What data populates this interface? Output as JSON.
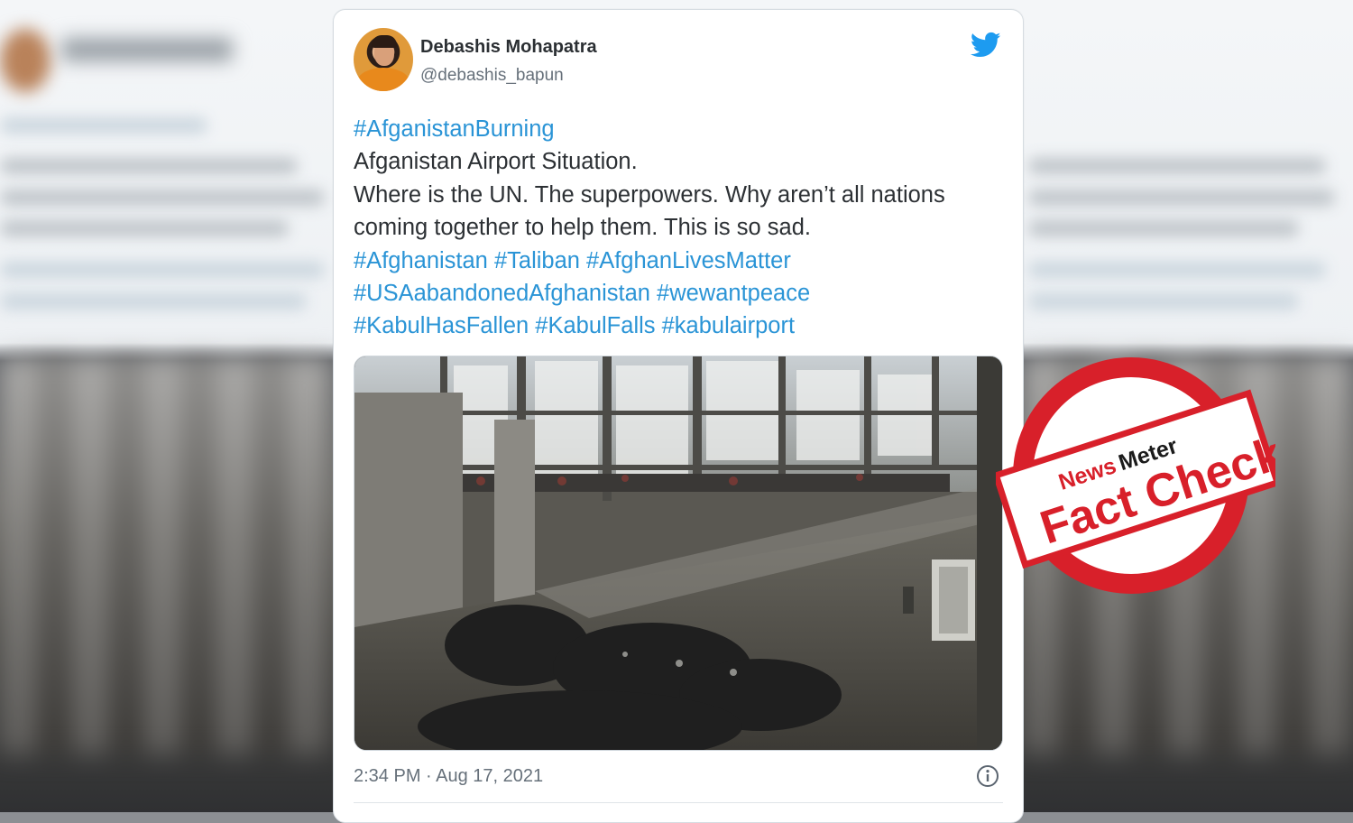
{
  "tweet": {
    "author_name": "Debashis Mohapatra",
    "author_handle": "@debashis_bapun",
    "lines": [
      {
        "text": "#AfganistanBurning",
        "hashtag": true
      },
      {
        "text": "Afganistan Airport Situation.",
        "hashtag": false
      },
      {
        "text": "Where is the UN. The superpowers. Why aren’t all nations",
        "hashtag": false
      },
      {
        "text": "coming together to help them. This is so sad.",
        "hashtag": false
      },
      {
        "text": "#Afghanistan #Taliban #AfghanLivesMatter",
        "hashtag": true
      },
      {
        "text": "#USAabandonedAfghanistan #wewantpeace",
        "hashtag": true
      },
      {
        "text": "#KabulHasFallen #KabulFalls #kabulairport",
        "hashtag": true
      }
    ],
    "timestamp": "2:34 PM · Aug 17, 2021"
  },
  "stamp": {
    "brand_news": "News",
    "brand_meter": "Meter",
    "label": "Fact Check",
    "color": "#d8202a"
  },
  "colors": {
    "hashtag": "#2a94d6",
    "twitter_blue": "#1d9bf0"
  },
  "icons": [
    "twitter-bird-icon",
    "info-icon"
  ]
}
